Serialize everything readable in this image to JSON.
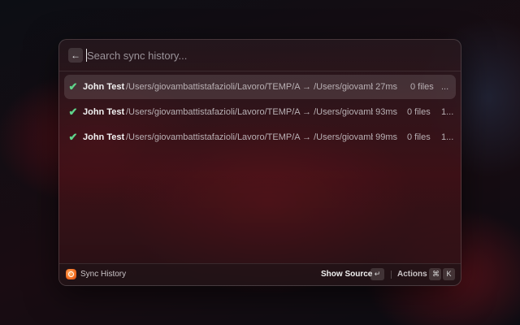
{
  "search": {
    "placeholder": "Search sync history...",
    "back_icon": "arrow-left-icon",
    "back_glyph": "←"
  },
  "history": {
    "items": [
      {
        "status": "success",
        "check_glyph": "✔",
        "name": "John Test",
        "path": "/Users/giovambattistafazioli/Lavoro/TEMP/A → /Users/giovamb...",
        "duration": "27ms",
        "files": "0 files",
        "extra": "...",
        "selected": true
      },
      {
        "status": "success",
        "check_glyph": "✔",
        "name": "John Test",
        "path": "/Users/giovambattistafazioli/Lavoro/TEMP/A → /Users/giovamb...",
        "duration": "93ms",
        "files": "0 files",
        "extra": "1...",
        "selected": false
      },
      {
        "status": "success",
        "check_glyph": "✔",
        "name": "John Test",
        "path": "/Users/giovambattistafazioli/Lavoro/TEMP/A → /Users/giovamb...",
        "duration": "99ms",
        "files": "0 files",
        "extra": "1...",
        "selected": false
      }
    ]
  },
  "footer": {
    "title": "Sync History",
    "primary_action": "Show Source",
    "primary_key": "↵",
    "actions_label": "Actions",
    "actions_keys": [
      "⌘",
      "K"
    ]
  },
  "colors": {
    "check": "#5fd38a",
    "accent": "#f06a1e"
  }
}
